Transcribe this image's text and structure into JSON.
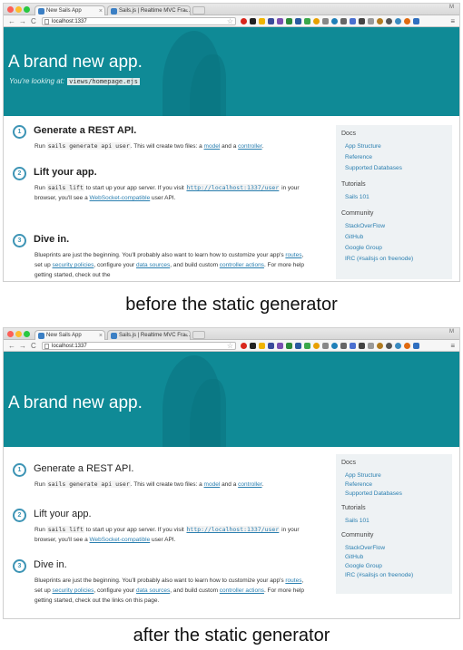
{
  "browser": {
    "tabs": [
      "New Sails App",
      "Sails.js | Realtime MVC Fra..."
    ],
    "tab_close": "×",
    "url": "localhost:1337",
    "user_initial": "M",
    "nav": {
      "back": "←",
      "forward": "→",
      "reload": "C"
    },
    "star": "☆",
    "menu": "≡"
  },
  "before": {
    "hero_title": "A brand new app.",
    "hero_subtitle": "You're looking at:",
    "hero_code": "views/homepage.ejs",
    "steps": [
      {
        "number": "1",
        "title": "Generate a REST API.",
        "body": [
          "Run ",
          "sails generate api user",
          ". This will create two files: a ",
          "model",
          " and a ",
          "controller",
          "."
        ]
      },
      {
        "number": "2",
        "title": "Lift your app.",
        "body": [
          "Run ",
          "sails lift",
          " to start up your app server. If you visit ",
          "http://localhost:1337/user",
          " in your browser, you'll see a ",
          "WebSocket-compatible",
          " user API."
        ]
      },
      {
        "number": "3",
        "title": "Dive in.",
        "body": [
          "Blueprints are just the beginning. You'll probably also want to learn how to customize your app's ",
          "routes",
          ", set up ",
          "security policies",
          ", configure your ",
          "data sources",
          ", and build custom ",
          "controller actions",
          ". For more help getting started, check out the"
        ]
      }
    ],
    "sidebar": {
      "docs_heading": "Docs",
      "docs": [
        "App Structure",
        "Reference",
        "Supported Databases"
      ],
      "tutorials_heading": "Tutorials",
      "tutorials": [
        "Sails 101"
      ],
      "community_heading": "Community",
      "community": [
        "StackOverFlow",
        "GitHub",
        "Google Group",
        "IRC (#sailsjs on freenode)"
      ]
    }
  },
  "after": {
    "hero_title": "A brand new app.",
    "steps": [
      {
        "number": "1",
        "title": "Generate a REST API.",
        "body": [
          "Run ",
          "sails generate api user",
          ". This will create two files: a ",
          "model",
          " and a ",
          "controller",
          "."
        ]
      },
      {
        "number": "2",
        "title": "Lift your app.",
        "body": [
          "Run ",
          "sails lift",
          " to start up your app server. If you visit ",
          "http://localhost:1337/user",
          " in your browser, you'll see a ",
          "WebSocket-compatible",
          " user API."
        ]
      },
      {
        "number": "3",
        "title": "Dive in.",
        "body": [
          "Blueprints are just the beginning. You'll probably also want to learn how to customize your app's ",
          "routes",
          ", set up ",
          "security policies",
          ", configure your ",
          "data sources",
          ", and build custom ",
          "controller actions",
          ". For more help getting started, check out the links on this page."
        ]
      }
    ],
    "sidebar": {
      "docs_heading": "Docs",
      "docs": [
        "App Structure",
        "Reference",
        "Supported Databases"
      ],
      "tutorials_heading": "Tutorials",
      "tutorials": [
        "Sails 101"
      ],
      "community_heading": "Community",
      "community": [
        "StackOverFlow",
        "GitHub",
        "Google Group",
        "IRC (#sailsjs on freenode)"
      ]
    }
  },
  "captions": {
    "before": "before the static generator",
    "after": "after the static generator"
  },
  "colors": {
    "hero_bg": "#0f8a96",
    "link": "#2a7fb0",
    "step_circle": "#3d94b5",
    "sidebar_bg": "#eef2f4"
  }
}
